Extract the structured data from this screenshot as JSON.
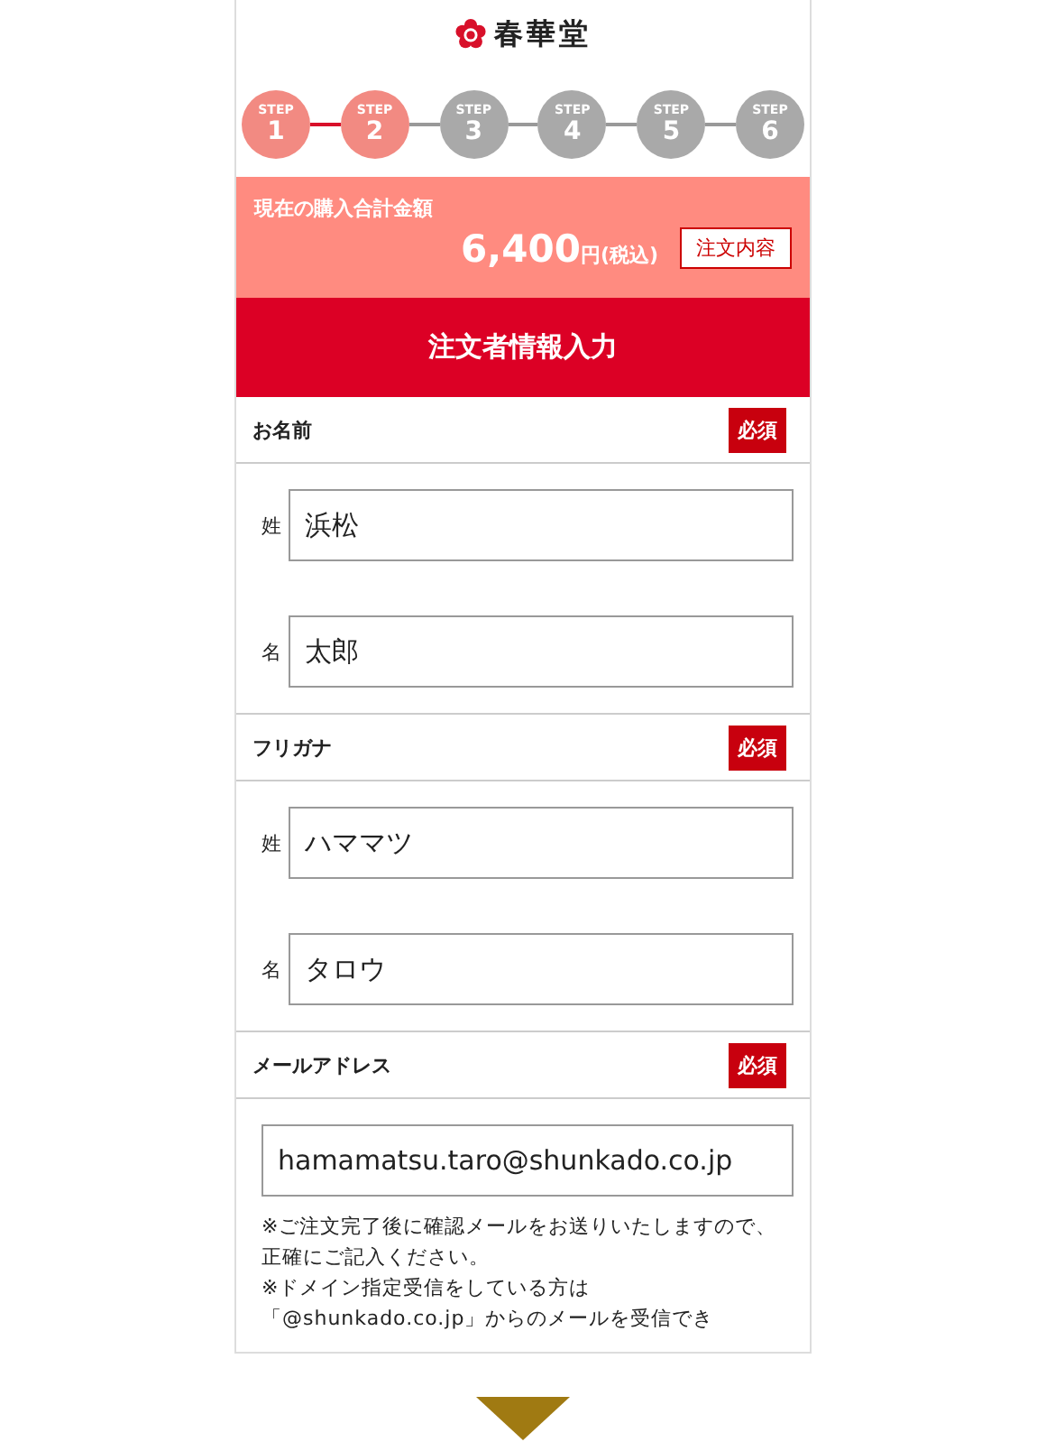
{
  "logo": {
    "name": "春華堂"
  },
  "steps": [
    {
      "label": "STEP",
      "number": "1",
      "completed": true
    },
    {
      "label": "STEP",
      "number": "2",
      "completed": true
    },
    {
      "label": "STEP",
      "number": "3",
      "completed": false
    },
    {
      "label": "STEP",
      "number": "4",
      "completed": false
    },
    {
      "label": "STEP",
      "number": "5",
      "completed": false
    },
    {
      "label": "STEP",
      "number": "6",
      "completed": false
    }
  ],
  "summary": {
    "label": "現在の購入合計金額",
    "amount": "6,400",
    "unit": "円(税込)",
    "button": "注文内容"
  },
  "heading": "注文者情報入力",
  "sections": [
    {
      "title": "お名前",
      "badge": "必須",
      "fields": [
        {
          "label": "姓",
          "value": "浜松"
        },
        {
          "label": "名",
          "value": "太郎"
        }
      ]
    },
    {
      "title": "フリガナ",
      "badge": "必須",
      "fields": [
        {
          "label": "姓",
          "value": "ハママツ"
        },
        {
          "label": "名",
          "value": "タロウ"
        }
      ]
    },
    {
      "title": "メールアドレス",
      "badge": "必須",
      "fields": [
        {
          "value": "hamamatsu.taro@shunkado.co.jp"
        }
      ],
      "notes": [
        "※ご注文完了後に確認メールをお送りいたしますので、正確にご記入ください。",
        "※ドメイン指定受信をしている方は「@shunkado.co.jp」からのメールを受信でき"
      ]
    }
  ]
}
